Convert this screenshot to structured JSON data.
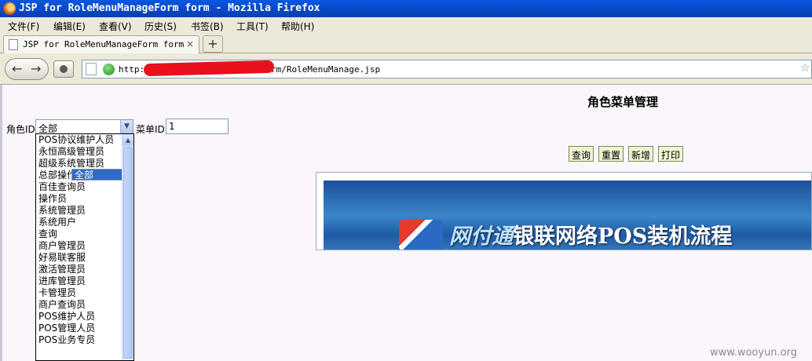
{
  "window": {
    "title": "JSP for RoleMenuManageForm form - Mozilla Firefox"
  },
  "menubar": {
    "items": [
      "文件(F)",
      "编辑(E)",
      "查看(V)",
      "历史(S)",
      "书签(B)",
      "工具(T)",
      "帮助(H)"
    ]
  },
  "tab": {
    "label": "JSP for RoleMenuManageForm form",
    "close": "×",
    "new_tab": "+"
  },
  "nav": {
    "back": "←",
    "forward": "→",
    "url_start": "http:",
    "url_end": "rm/RoleMenuManage.jsp"
  },
  "page": {
    "heading": "角色菜单管理",
    "role_label": "角色ID",
    "role_selected": "全部",
    "menu_label": "菜单ID",
    "menu_value": "1",
    "buttons": {
      "query": "查询",
      "reset": "重置",
      "add": "新增",
      "print": "打印"
    },
    "banner": {
      "brand": "网付通",
      "text": "银联网络POS装机流程"
    }
  },
  "dropdown": {
    "options": [
      "全部",
      "POS协议维护人员",
      "永恒高级管理员",
      "超级系统管理员",
      "总部操作员",
      "百佳查询员",
      "操作员",
      "系统管理员",
      "系统用户",
      "查询",
      "商户管理员",
      "好易联客服",
      "激活管理员",
      "进库管理员",
      "卡管理员",
      "商户查询员",
      "POS维护人员",
      "POS管理人员",
      "POS业务专员"
    ],
    "selected_index": 0
  },
  "watermark": "www.wooyun.org"
}
